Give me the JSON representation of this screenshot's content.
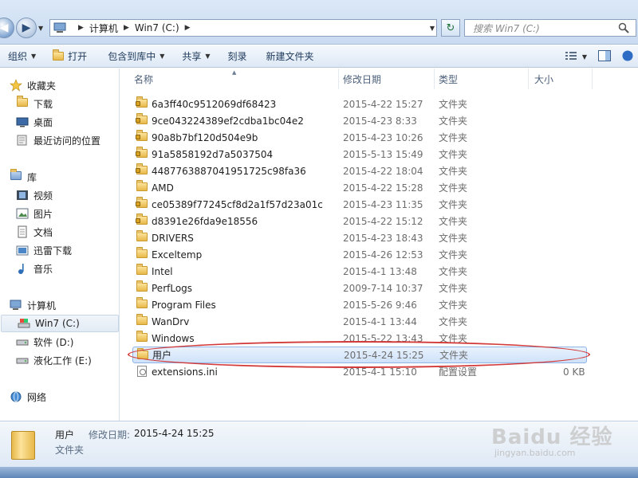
{
  "address": {
    "crumbs": [
      "计算机",
      "Win7 (C:)"
    ],
    "search_placeholder": "搜索 Win7 (C:)"
  },
  "toolbar": {
    "organize": "组织",
    "open": "打开",
    "include_in_library": "包含到库中",
    "share": "共享",
    "burn": "刻录",
    "new_folder": "新建文件夹"
  },
  "nav": {
    "favorites": "收藏夹",
    "downloads": "下载",
    "desktop": "桌面",
    "recent": "最近访问的位置",
    "libraries": "库",
    "videos": "视频",
    "pictures": "图片",
    "documents": "文档",
    "thunder": "迅雷下载",
    "music": "音乐",
    "computer": "计算机",
    "drive_c": "Win7 (C:)",
    "drive_d": "软件 (D:)",
    "drive_e": "液化工作 (E:)",
    "network": "网络"
  },
  "columns": {
    "name": "名称",
    "date": "修改日期",
    "type": "类型",
    "size": "大小"
  },
  "files": [
    {
      "name": "6a3ff40c9512069df68423",
      "date": "2015-4-22 15:27",
      "type": "文件夹",
      "size": ""
    },
    {
      "name": "9ce043224389ef2cdba1bc04e2",
      "date": "2015-4-23 8:33",
      "type": "文件夹",
      "size": ""
    },
    {
      "name": "90a8b7bf120d504e9b",
      "date": "2015-4-23 10:26",
      "type": "文件夹",
      "size": ""
    },
    {
      "name": "91a5858192d7a5037504",
      "date": "2015-5-13 15:49",
      "type": "文件夹",
      "size": ""
    },
    {
      "name": "4487763887041951725c98fa36",
      "date": "2015-4-22 18:04",
      "type": "文件夹",
      "size": ""
    },
    {
      "name": "AMD",
      "date": "2015-4-22 15:28",
      "type": "文件夹",
      "size": ""
    },
    {
      "name": "ce05389f77245cf8d2a1f57d23a01c",
      "date": "2015-4-23 11:35",
      "type": "文件夹",
      "size": ""
    },
    {
      "name": "d8391e26fda9e18556",
      "date": "2015-4-22 15:12",
      "type": "文件夹",
      "size": ""
    },
    {
      "name": "DRIVERS",
      "date": "2015-4-23 18:43",
      "type": "文件夹",
      "size": ""
    },
    {
      "name": "Exceltemp",
      "date": "2015-4-26 12:53",
      "type": "文件夹",
      "size": ""
    },
    {
      "name": "Intel",
      "date": "2015-4-1 13:48",
      "type": "文件夹",
      "size": ""
    },
    {
      "name": "PerfLogs",
      "date": "2009-7-14 10:37",
      "type": "文件夹",
      "size": ""
    },
    {
      "name": "Program Files",
      "date": "2015-5-26 9:46",
      "type": "文件夹",
      "size": ""
    },
    {
      "name": "WanDrv",
      "date": "2015-4-1 13:44",
      "type": "文件夹",
      "size": ""
    },
    {
      "name": "Windows",
      "date": "2015-5-22 13:43",
      "type": "文件夹",
      "size": ""
    },
    {
      "name": "用户",
      "date": "2015-4-24 15:25",
      "type": "文件夹",
      "size": ""
    },
    {
      "name": "extensions.ini",
      "date": "2015-4-1 15:10",
      "type": "配置设置",
      "size": "0 KB"
    }
  ],
  "details": {
    "name": "用户",
    "date_label": "修改日期:",
    "date": "2015-4-24 15:25",
    "type": "文件夹"
  },
  "watermark": {
    "logo": "Baidu 经验",
    "url": "jingyan.baidu.com"
  },
  "colors": {
    "accent": "#2e5c93",
    "selection": "#cfe2fa",
    "annotation": "#d23a3a"
  }
}
